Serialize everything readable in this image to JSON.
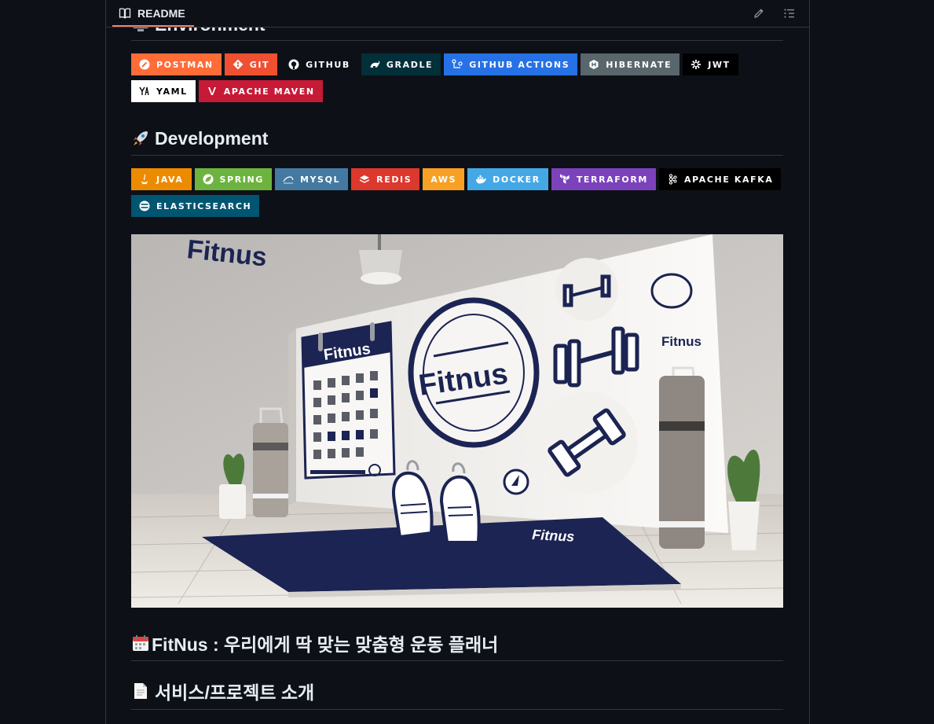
{
  "readme": {
    "tab_label": "README",
    "edit_label": "Edit file",
    "outline_label": "Outline"
  },
  "sections": {
    "environment": "Environment",
    "development": "Development",
    "fitnus_heading": "FitNus : 우리에게 딱 맞는 맞춤형 운동 플래너",
    "service_heading": "서비스/프로젝트 소개"
  },
  "badges": {
    "environment": [
      {
        "label": "POSTMAN",
        "color": "#FF6C37",
        "icon": "postman-icon"
      },
      {
        "label": "GIT",
        "color": "#F05032",
        "icon": "git-icon"
      },
      {
        "label": "GITHUB",
        "color": "#181717",
        "icon": "github-icon"
      },
      {
        "label": "GRADLE",
        "color": "#02303A",
        "icon": "gradle-icon"
      },
      {
        "label": "GITHUB ACTIONS",
        "color": "#2671E5",
        "icon": "github-actions-icon"
      },
      {
        "label": "HIBERNATE",
        "color": "#59666C",
        "icon": "hibernate-icon"
      },
      {
        "label": "JWT",
        "color": "#000000",
        "icon": "jwt-icon"
      },
      {
        "label": "YAML",
        "color": "#FFFFFF",
        "icon": "yaml-icon"
      },
      {
        "label": "APACHE MAVEN",
        "color": "#C71A36",
        "icon": "maven-icon"
      }
    ],
    "development": [
      {
        "label": "JAVA",
        "color": "#ED8B00",
        "icon": "java-icon"
      },
      {
        "label": "SPRING",
        "color": "#6DB33F",
        "icon": "spring-icon"
      },
      {
        "label": "MYSQL",
        "color": "#4479A1",
        "icon": "mysql-icon"
      },
      {
        "label": "REDIS",
        "color": "#DC382D",
        "icon": "redis-icon"
      },
      {
        "label": "AWS",
        "color": "#F7A024",
        "icon": "aws-icon"
      },
      {
        "label": "DOCKER",
        "color": "#2496ED",
        "icon": "docker-icon"
      },
      {
        "label": "TERRAFORM",
        "color": "#7B42BC",
        "icon": "terraform-icon"
      },
      {
        "label": "APACHE KAFKA",
        "color": "#000000",
        "icon": "kafka-icon"
      },
      {
        "label": "ELASTICSEARCH",
        "color": "#005571",
        "icon": "elasticsearch-icon"
      }
    ]
  },
  "hero": {
    "brand_wall": "Fitnus",
    "brand_calendar": "Fitnus",
    "brand_center": "Fitnus",
    "brand_right": "Fitnus",
    "brand_mat": "Fitnus"
  },
  "colors": {
    "background": "#0d1117",
    "border": "#30363d",
    "accent": "#f78166",
    "navy": "#1b2452"
  }
}
